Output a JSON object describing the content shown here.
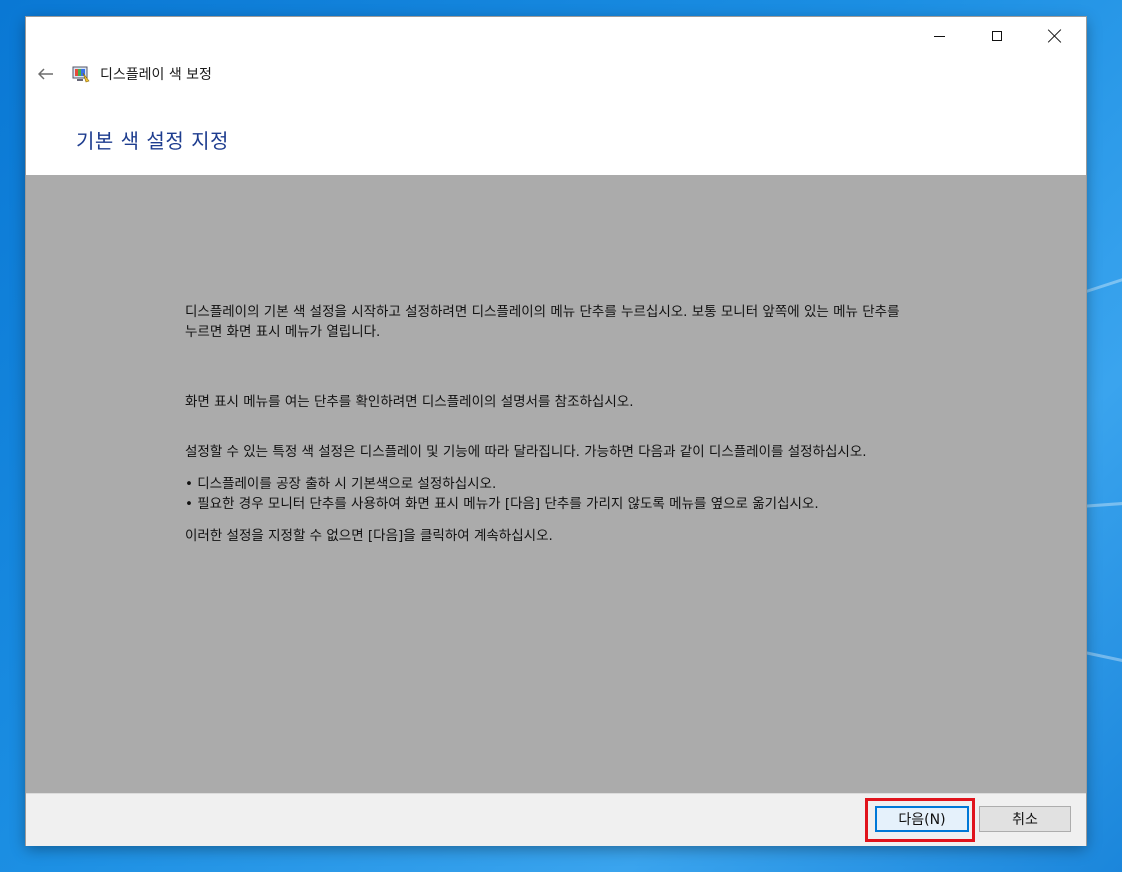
{
  "window": {
    "app_title": "디스플레이 색 보정",
    "page_title": "기본 색 설정 지정"
  },
  "icons": {
    "back": "back-arrow-icon",
    "app": "display-color-calibration-icon",
    "minimize": "minimize-icon",
    "maximize": "maximize-icon",
    "close": "close-icon"
  },
  "content": {
    "p1": "디스플레이의 기본 색 설정을 시작하고 설정하려면 디스플레이의 메뉴 단추를 누르십시오. 보통 모니터 앞쪽에 있는 메뉴 단추를 누르면 화면 표시 메뉴가 열립니다.",
    "p2": "화면 표시 메뉴를 여는 단추를 확인하려면 디스플레이의 설명서를 참조하십시오.",
    "p3": "설정할 수 있는 특정 색 설정은 디스플레이 및 기능에 따라 달라집니다. 가능하면 다음과 같이 디스플레이를 설정하십시오.",
    "bullet1": "• 디스플레이를 공장 출하 시 기본색으로 설정하십시오.",
    "bullet2": "• 필요한 경우 모니터 단추를 사용하여 화면 표시 메뉴가 [다음] 단추를 가리지 않도록 메뉴를 옆으로 옮기십시오.",
    "p4": "이러한 설정을 지정할 수 없으면 [다음]을 클릭하여 계속하십시오."
  },
  "footer": {
    "next_label": "다음(N)",
    "cancel_label": "취소"
  },
  "colors": {
    "content_bg": "#ababab",
    "title_color": "#1e3d8f",
    "highlight": "#e0131c",
    "desktop": "#1c8fe3"
  }
}
